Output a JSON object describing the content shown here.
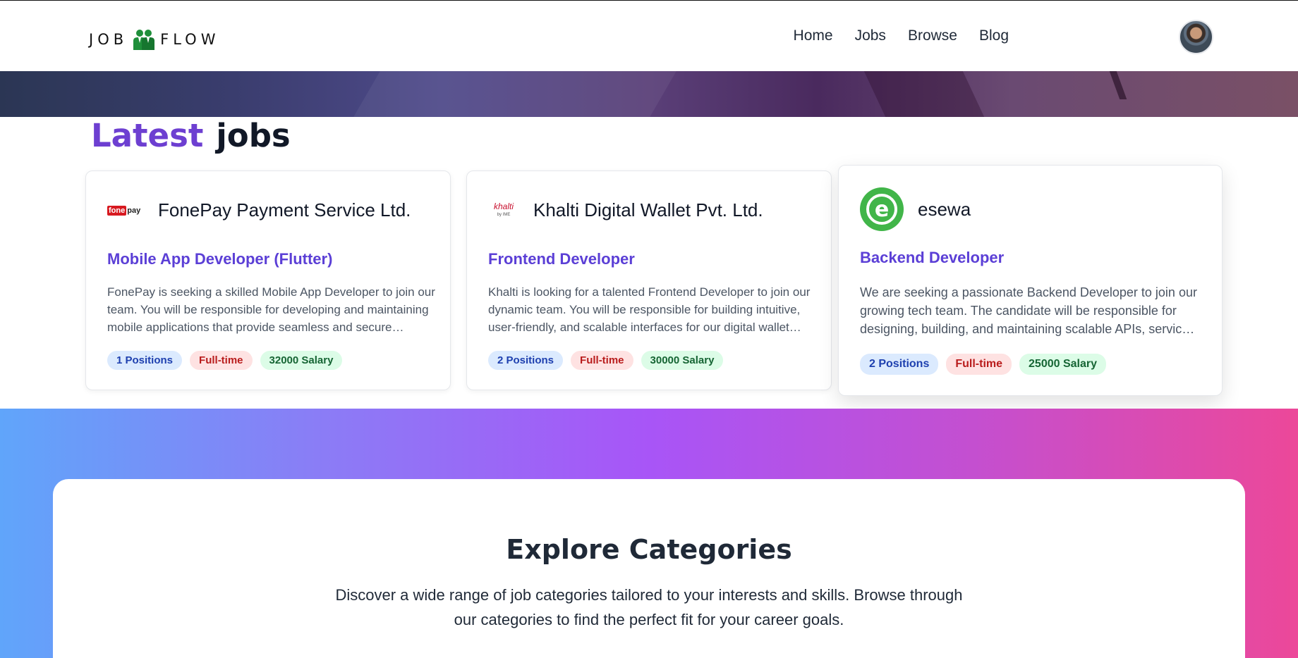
{
  "brand": {
    "left": "JOB",
    "right": "FLOW"
  },
  "nav": {
    "items": [
      "Home",
      "Jobs",
      "Browse",
      "Blog"
    ]
  },
  "latest": {
    "accent": "Latest",
    "rest": "jobs"
  },
  "jobs": [
    {
      "company": "FonePay Payment Service Ltd.",
      "logo_text": "fone",
      "logo_text2": "pay",
      "title": "Mobile App Developer (Flutter)",
      "description": "FonePay is seeking a skilled Mobile App Developer to join our team. You will be responsible for developing and maintaining mobile applications that provide seamless and secure payment experiences.",
      "positions": "1 Positions",
      "type": "Full-time",
      "salary": "32000 Salary"
    },
    {
      "company": "Khalti Digital Wallet Pvt. Ltd.",
      "logo_text": "khalti",
      "logo_text2": "by IME",
      "title": "Frontend Developer",
      "description": "Khalti is looking for a talented Frontend Developer to join our dynamic team. You will be responsible for building intuitive, user-friendly, and scalable interfaces for our digital wallet platform.",
      "positions": "2 Positions",
      "type": "Full-time",
      "salary": "30000 Salary"
    },
    {
      "company": "esewa",
      "logo_text": "e",
      "title": "Backend Developer",
      "description": "We are seeking a passionate Backend Developer to join our growing tech team. The candidate will be responsible for designing, building, and maintaining scalable APIs, services and databases.",
      "positions": "2 Positions",
      "type": "Full-time",
      "salary": "25000 Salary"
    }
  ],
  "categories": {
    "title": "Explore Categories",
    "description": "Discover a wide range of job categories tailored to your interests and skills. Browse through our categories to find the perfect fit for your career goals."
  },
  "colors": {
    "accent": "#6d3fd1",
    "job_title": "#5b3fd6",
    "esewa_green": "#41b549",
    "fonepay_red": "#d71920"
  }
}
